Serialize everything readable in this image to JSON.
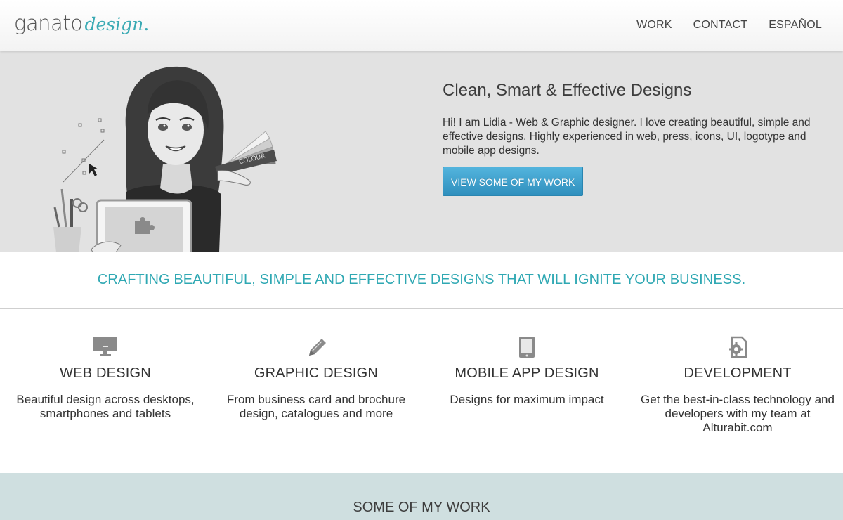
{
  "brand": {
    "logo_main": "ganato",
    "logo_sub": "design",
    "logo_dot": ".",
    "accent_color": "#3aaab4"
  },
  "nav": {
    "items": [
      "WORK",
      "CONTACT",
      "ESPAÑOL"
    ]
  },
  "hero": {
    "title": "Clean, Smart & Effective Designs",
    "description": "Hi! I am Lidia - Web & Graphic designer. I love creating beautiful, simple and effective designs. Highly experienced in web, press, icons, UI, logotype and mobile app designs.",
    "button_label": "VIEW SOME OF MY WORK",
    "illustration_swatch_text": "COLOUR"
  },
  "tagline": "CRAFTING BEAUTIFUL, SIMPLE AND EFFECTIVE DESIGNS THAT WILL IGNITE YOUR BUSINESS.",
  "services": [
    {
      "icon": "monitor-icon",
      "title": "WEB DESIGN",
      "description": "Beautiful design across desktops, smartphones and tablets"
    },
    {
      "icon": "pencil-icon",
      "title": "GRAPHIC DESIGN",
      "description": "From business card and brochure design, catalogues and more"
    },
    {
      "icon": "tablet-icon",
      "title": "MOBILE APP DESIGN",
      "description": "Designs for maximum impact"
    },
    {
      "icon": "gear-document-icon",
      "title": "DEVELOPMENT",
      "description": "Get the best-in-class technology and developers with my team at Alturabit.com"
    }
  ],
  "work_section": {
    "title": "SOME OF MY WORK"
  }
}
